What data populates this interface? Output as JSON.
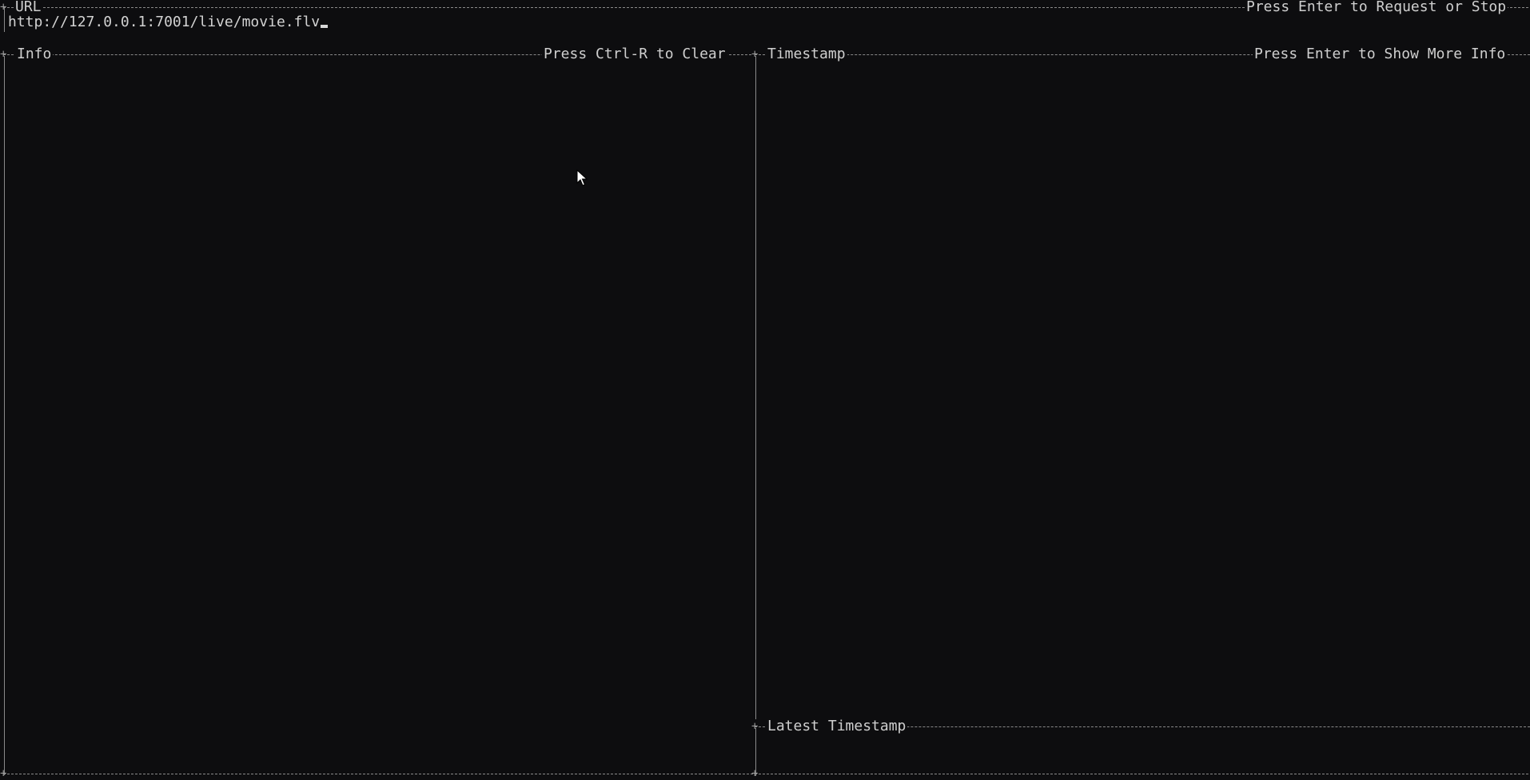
{
  "url_panel": {
    "title": "URL",
    "hint": "Press Enter to Request or Stop",
    "value": "http://127.0.0.1:7001/live/movie.flv"
  },
  "info_panel": {
    "title": "Info",
    "hint": "Press Ctrl-R to Clear"
  },
  "timestamp_panel": {
    "title": "Timestamp",
    "hint": "Press Enter to Show More Info"
  },
  "latest_timestamp_panel": {
    "title": "Latest Timestamp"
  },
  "icons": {
    "mouse": "mouse-pointer-icon",
    "caret": "text-cursor-icon"
  },
  "colors": {
    "background": "#0d0d0f",
    "border": "#8a8a8a",
    "text": "#c8c8c8"
  }
}
